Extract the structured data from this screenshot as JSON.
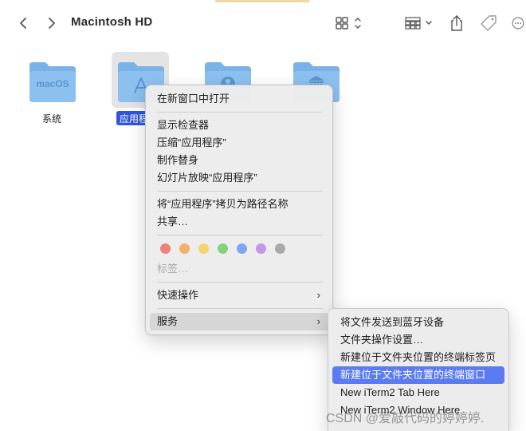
{
  "window": {
    "title": "Macintosh HD"
  },
  "toolbar": {
    "back_icon": "chevron-left-icon",
    "forward_icon": "chevron-right-icon",
    "view_icon": "grid-view-icon",
    "group_icon": "group-view-icon",
    "share_icon": "share-icon",
    "tag_icon": "tag-icon",
    "more_icon": "more-icon"
  },
  "folders": [
    {
      "label": "系统",
      "badge": "macOS",
      "icon": "macos-folder-icon"
    },
    {
      "label": "应用程序",
      "badge": "",
      "icon": "applications-folder-icon",
      "selected": true
    },
    {
      "label": "",
      "badge": "",
      "icon": "users-folder-icon"
    },
    {
      "label": "",
      "badge": "",
      "icon": "library-folder-icon"
    }
  ],
  "context_menu": {
    "items": [
      "在新窗口中打开",
      "显示检查器",
      "压缩“应用程序”",
      "制作替身",
      "幻灯片放映“应用程序”",
      "将“应用程序”拷贝为路径名称",
      "共享…",
      "标签…",
      "快速操作",
      "服务"
    ],
    "submenu_arrow": "›",
    "tag_colors": [
      "#ee7f7a",
      "#f2b069",
      "#f4d36a",
      "#84d27f",
      "#7fa6ef",
      "#c596e6",
      "#a9a9a9"
    ]
  },
  "services_submenu": {
    "items": [
      "将文件发送到蓝牙设备",
      "文件夹操作设置…",
      "新建位于文件夹位置的终端标签页",
      "新建位于文件夹位置的终端窗口",
      "New iTerm2 Tab Here",
      "New iTerm2 Window Here"
    ],
    "active_index": 3
  },
  "watermark": "CSDN @爱敲代码的婷婷婷."
}
